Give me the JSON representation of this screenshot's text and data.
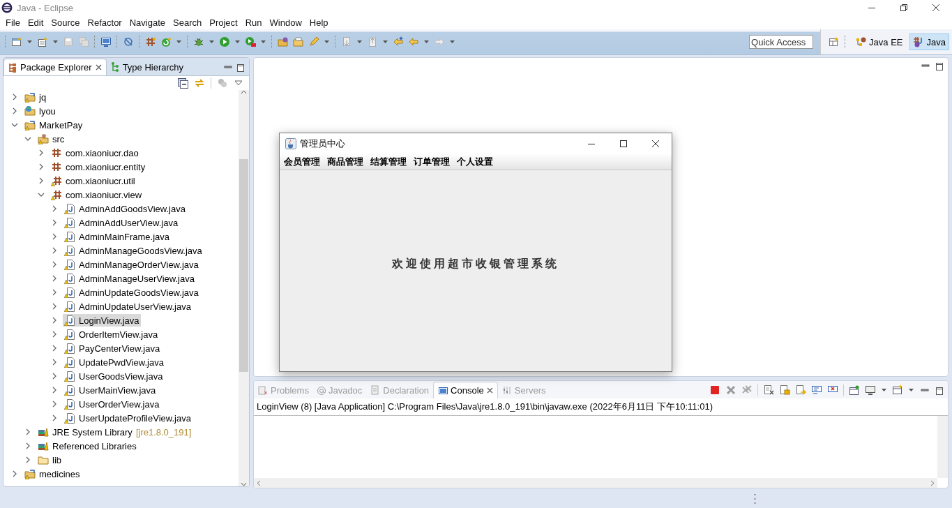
{
  "window": {
    "title": "Java - Eclipse"
  },
  "menu": [
    "File",
    "Edit",
    "Source",
    "Refactor",
    "Navigate",
    "Search",
    "Project",
    "Run",
    "Window",
    "Help"
  ],
  "quick_access": {
    "placeholder": "Quick Access"
  },
  "perspectives": [
    {
      "label": "Java EE",
      "selected": false
    },
    {
      "label": "Java",
      "selected": true
    }
  ],
  "left_tabs": [
    {
      "label": "Package Explorer",
      "selected": true
    },
    {
      "label": "Type Hierarchy",
      "selected": false
    }
  ],
  "tree": [
    {
      "label": "jq",
      "kind": "project",
      "expanded": false,
      "selected": false
    },
    {
      "label": "lyou",
      "kind": "web-project",
      "expanded": false,
      "selected": false
    },
    {
      "label": "MarketPay",
      "kind": "project",
      "expanded": true,
      "selected": false,
      "children": [
        {
          "label": "src",
          "kind": "source-folder",
          "expanded": true,
          "selected": false,
          "children": [
            {
              "label": "com.xiaoniucr.dao",
              "kind": "package",
              "expanded": false,
              "selected": false
            },
            {
              "label": "com.xiaoniucr.entity",
              "kind": "package",
              "expanded": false,
              "selected": false
            },
            {
              "label": "com.xiaoniucr.util",
              "kind": "package-warning",
              "expanded": false,
              "selected": false
            },
            {
              "label": "com.xiaoniucr.view",
              "kind": "package-warning",
              "expanded": true,
              "selected": false,
              "children": [
                {
                  "label": "AdminAddGoodsView.java",
                  "kind": "java-file",
                  "expanded": false,
                  "selected": false
                },
                {
                  "label": "AdminAddUserView.java",
                  "kind": "java-file",
                  "expanded": false,
                  "selected": false
                },
                {
                  "label": "AdminMainFrame.java",
                  "kind": "java-file",
                  "expanded": false,
                  "selected": false
                },
                {
                  "label": "AdminManageGoodsView.java",
                  "kind": "java-file",
                  "expanded": false,
                  "selected": false
                },
                {
                  "label": "AdminManageOrderView.java",
                  "kind": "java-file",
                  "expanded": false,
                  "selected": false
                },
                {
                  "label": "AdminManageUserView.java",
                  "kind": "java-file",
                  "expanded": false,
                  "selected": false
                },
                {
                  "label": "AdminUpdateGoodsView.java",
                  "kind": "java-file",
                  "expanded": false,
                  "selected": false
                },
                {
                  "label": "AdminUpdateUserView.java",
                  "kind": "java-file",
                  "expanded": false,
                  "selected": false
                },
                {
                  "label": "LoginView.java",
                  "kind": "java-file",
                  "expanded": false,
                  "selected": true
                },
                {
                  "label": "OrderItemView.java",
                  "kind": "java-file",
                  "expanded": false,
                  "selected": false
                },
                {
                  "label": "PayCenterView.java",
                  "kind": "java-file",
                  "expanded": false,
                  "selected": false
                },
                {
                  "label": "UpdatePwdView.java",
                  "kind": "java-file",
                  "expanded": false,
                  "selected": false
                },
                {
                  "label": "UserGoodsView.java",
                  "kind": "java-file",
                  "expanded": false,
                  "selected": false
                },
                {
                  "label": "UserMainView.java",
                  "kind": "java-file",
                  "expanded": false,
                  "selected": false
                },
                {
                  "label": "UserOrderView.java",
                  "kind": "java-file",
                  "expanded": false,
                  "selected": false
                },
                {
                  "label": "UserUpdateProfileView.java",
                  "kind": "java-file",
                  "expanded": false,
                  "selected": false
                }
              ]
            }
          ]
        },
        {
          "label": "JRE System Library",
          "decoration": "[jre1.8.0_191]",
          "kind": "library",
          "expanded": false,
          "selected": false
        },
        {
          "label": "Referenced Libraries",
          "kind": "library",
          "expanded": false,
          "selected": false
        },
        {
          "label": "lib",
          "kind": "folder",
          "expanded": false,
          "selected": false
        }
      ]
    },
    {
      "label": "medicines",
      "kind": "project",
      "expanded": false,
      "selected": false
    }
  ],
  "console_tabs": [
    {
      "label": "Problems",
      "selected": false
    },
    {
      "label": "Javadoc",
      "selected": false
    },
    {
      "label": "Declaration",
      "selected": false
    },
    {
      "label": "Console",
      "selected": true
    },
    {
      "label": "Servers",
      "selected": false
    }
  ],
  "console": {
    "text": "LoginView (8) [Java Application] C:\\Program Files\\Java\\jre1.8.0_191\\bin\\javaw.exe (2022年6月11日 下午10:11:01)"
  },
  "app_window": {
    "title": "管理员中心",
    "menu": [
      "会员管理",
      "商品管理",
      "结算管理",
      "订单管理",
      "个人设置"
    ],
    "welcome": "欢迎使用超市收银管理系统"
  }
}
